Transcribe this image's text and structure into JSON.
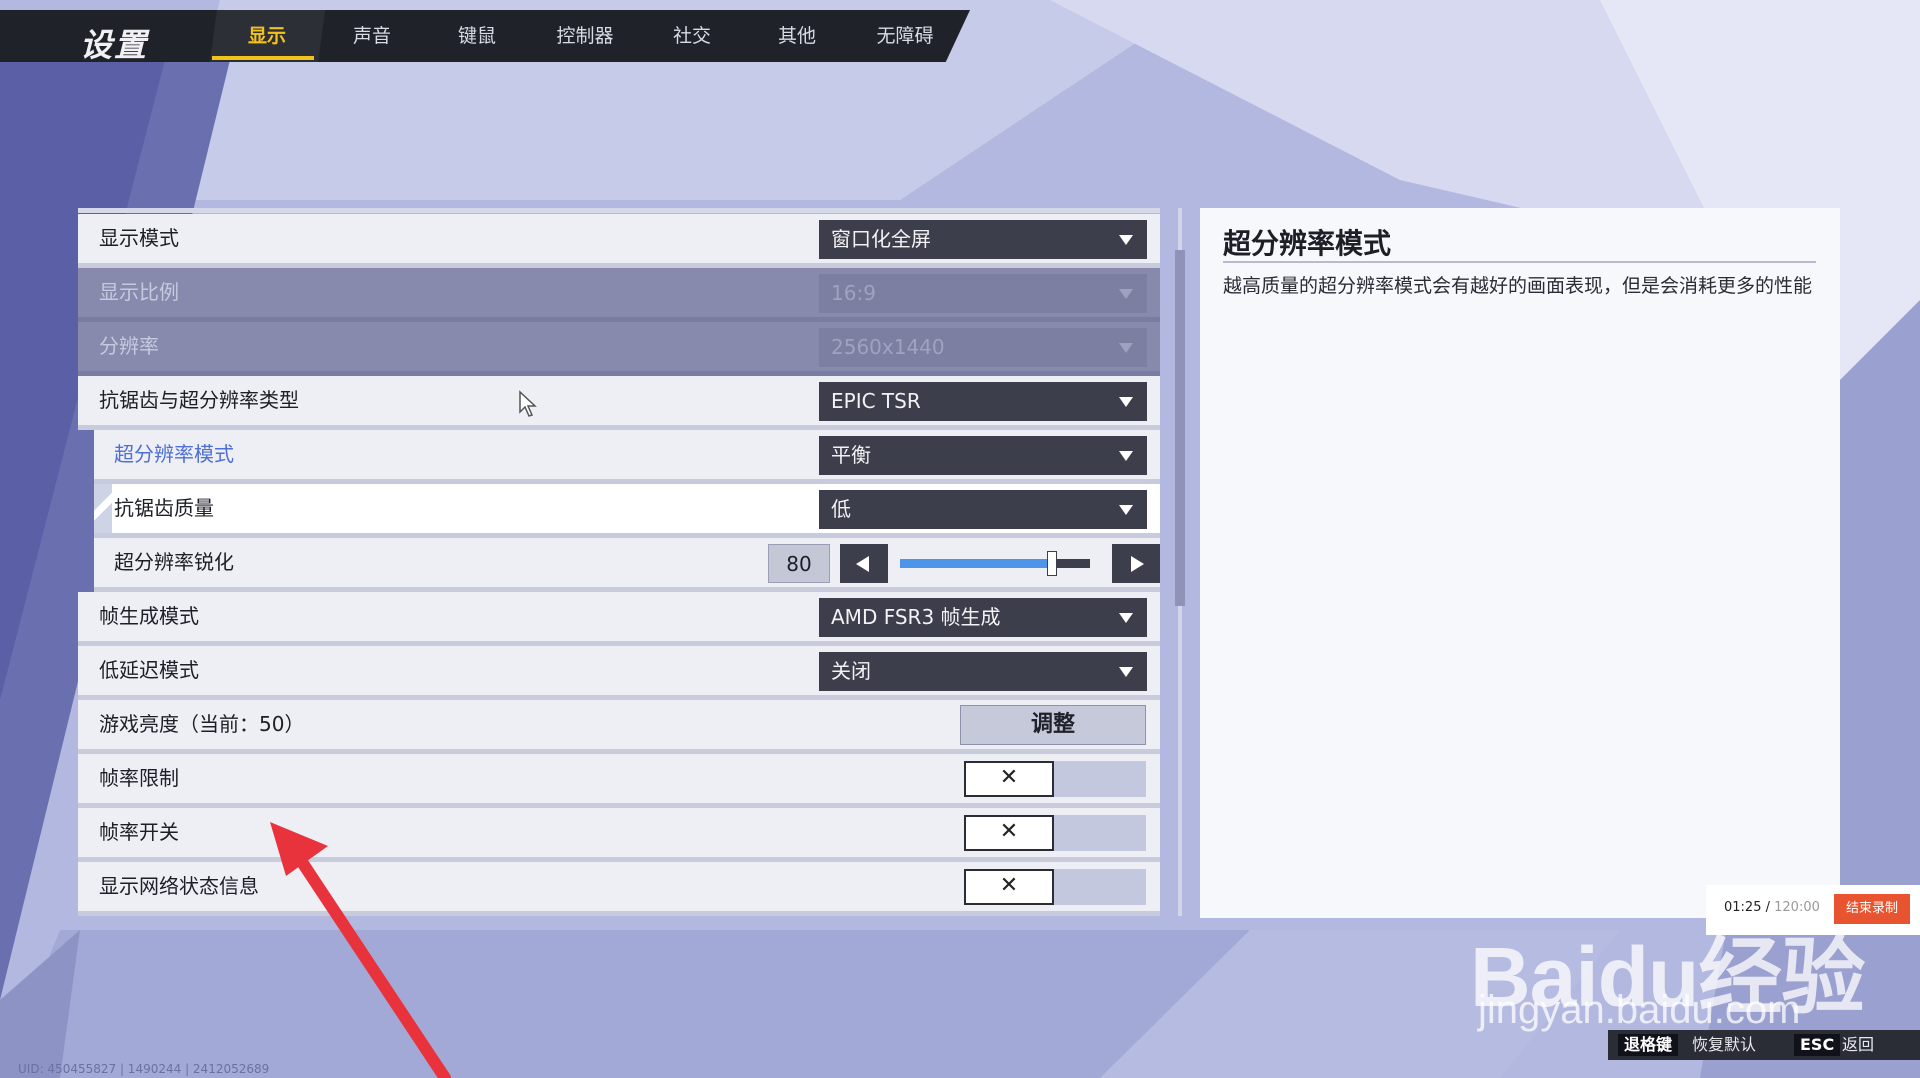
{
  "header": {
    "title": "设置",
    "tabs": [
      {
        "label": "显示",
        "active": true
      },
      {
        "label": "声音"
      },
      {
        "label": "键鼠"
      },
      {
        "label": "控制器"
      },
      {
        "label": "社交"
      },
      {
        "label": "其他"
      },
      {
        "label": "无障碍"
      }
    ]
  },
  "settings": {
    "display_mode": {
      "label": "显示模式",
      "value": "窗口化全屏"
    },
    "aspect_ratio": {
      "label": "显示比例",
      "value": "16:9",
      "disabled": true
    },
    "resolution": {
      "label": "分辨率",
      "value": "2560x1440",
      "disabled": true
    },
    "aa_type": {
      "label": "抗锯齿与超分辨率类型",
      "value": "EPIC TSR"
    },
    "sr_mode": {
      "label": "超分辨率模式",
      "value": "平衡"
    },
    "aa_quality": {
      "label": "抗锯齿质量",
      "value": "低"
    },
    "sr_sharpen": {
      "label": "超分辨率锐化",
      "value": "80",
      "fraction": 0.8
    },
    "frame_gen": {
      "label": "帧生成模式",
      "value": "AMD FSR3 帧生成"
    },
    "low_latency": {
      "label": "低延迟模式",
      "value": "关闭"
    },
    "brightness": {
      "label": "游戏亮度（当前：50）",
      "button": "调整"
    },
    "fps_limit": {
      "label": "帧率限制",
      "toggle": "✕"
    },
    "fps_switch": {
      "label": "帧率开关",
      "toggle": "✕"
    },
    "net_status": {
      "label": "显示网络状态信息",
      "toggle": "✕"
    }
  },
  "info": {
    "title": "超分辨率模式",
    "description": "越高质量的超分辨率模式会有越好的画面表现，但是会消耗更多的性能"
  },
  "recording": {
    "elapsed": "01:25",
    "total": "120:00",
    "stop_label": "结束录制"
  },
  "watermark": {
    "brand": "Baidu经验",
    "url": "jingyan.baidu.com"
  },
  "footer": {
    "hints": [
      {
        "key": "退格键",
        "label": "恢复默认"
      },
      {
        "key": "ESC",
        "label": "返回"
      }
    ],
    "uid": "UID: 450455827 | 1490244 | 2412052689"
  },
  "colors": {
    "accent": "#f3c21a",
    "panel": "#eeeff5",
    "dark": "#3c3e4b",
    "slider": "#4e94e8",
    "record": "#e8542f"
  }
}
